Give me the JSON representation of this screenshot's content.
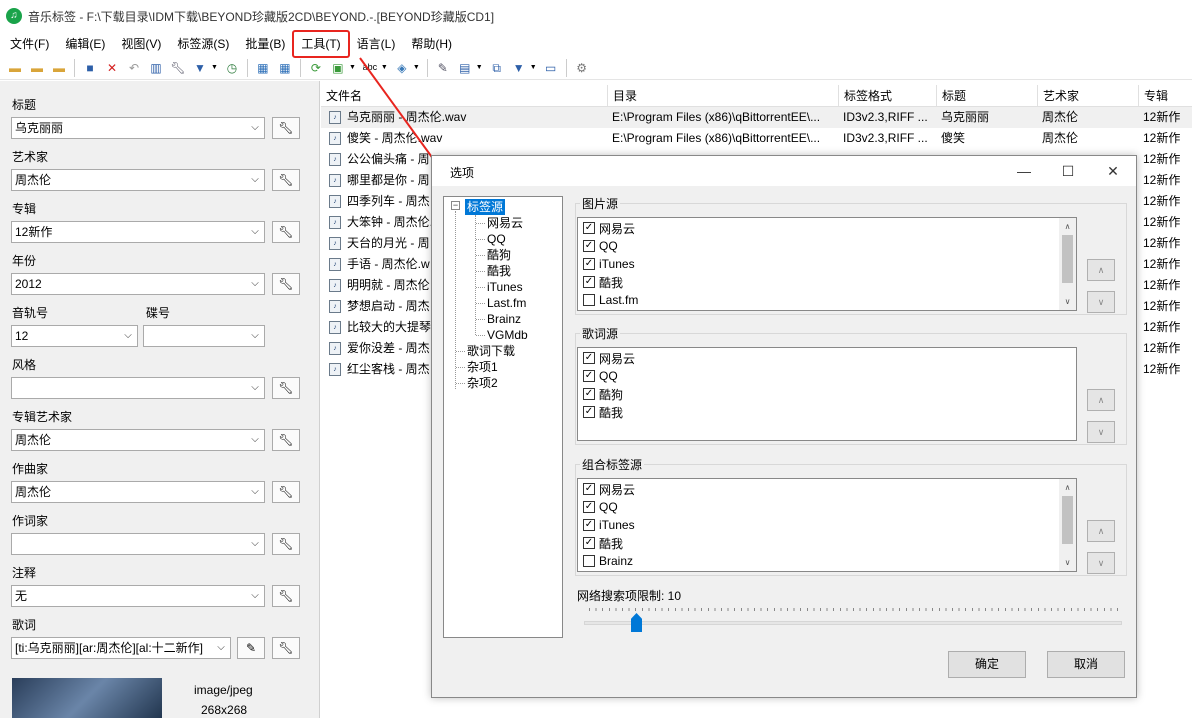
{
  "window": {
    "title": "音乐标签 - F:\\下载目录\\IDM下载\\BEYOND珍藏版2CD\\BEYOND.-.[BEYOND珍藏版CD1]",
    "app_icon": "music-note-icon"
  },
  "menu": [
    {
      "label": "文件(F)"
    },
    {
      "label": "编辑(E)"
    },
    {
      "label": "视图(V)"
    },
    {
      "label": "标签源(S)"
    },
    {
      "label": "批量(B)"
    },
    {
      "label": "工具(T)",
      "highlighted": true
    },
    {
      "label": "语言(L)"
    },
    {
      "label": "帮助(H)"
    }
  ],
  "left_panel": {
    "fields": {
      "title": {
        "label": "标题",
        "value": "乌克丽丽"
      },
      "artist": {
        "label": "艺术家",
        "value": "周杰伦"
      },
      "album": {
        "label": "专辑",
        "value": "12新作"
      },
      "year": {
        "label": "年份",
        "value": "2012"
      },
      "track": {
        "label": "音轨号",
        "value": "12"
      },
      "disc": {
        "label": "碟号",
        "value": ""
      },
      "genre": {
        "label": "风格",
        "value": ""
      },
      "album_artist": {
        "label": "专辑艺术家",
        "value": "周杰伦"
      },
      "composer": {
        "label": "作曲家",
        "value": "周杰伦"
      },
      "lyricist": {
        "label": "作词家",
        "value": ""
      },
      "comment": {
        "label": "注释",
        "value": "无"
      },
      "lyrics": {
        "label": "歌词",
        "value": "[ti:乌克丽丽][ar:周杰伦][al:十二新作]"
      }
    },
    "cover": {
      "mime": "image/jpeg",
      "dims": "268x268"
    }
  },
  "file_list": {
    "columns": [
      "文件名",
      "目录",
      "标签格式",
      "标题",
      "艺术家",
      "专辑"
    ],
    "rows": [
      {
        "filename": "乌克丽丽 - 周杰伦.wav",
        "dir": "E:\\Program Files (x86)\\qBittorrentEE\\...",
        "format": "ID3v2.3,RIFF ...",
        "title": "乌克丽丽",
        "artist": "周杰伦",
        "album": "12新作"
      },
      {
        "filename": "傻笑 - 周杰伦.wav",
        "dir": "E:\\Program Files (x86)\\qBittorrentEE\\...",
        "format": "ID3v2.3,RIFF ...",
        "title": "傻笑",
        "artist": "周杰伦",
        "album": "12新作"
      },
      {
        "filename": "公公偏头痛 - 周",
        "dir": "",
        "format": "",
        "title": "",
        "artist": "",
        "album": "12新作"
      },
      {
        "filename": "哪里都是你 - 周",
        "dir": "",
        "format": "",
        "title": "",
        "artist": "",
        "album": "12新作"
      },
      {
        "filename": "四季列车 - 周杰",
        "dir": "",
        "format": "",
        "title": "",
        "artist": "",
        "album": "12新作"
      },
      {
        "filename": "大笨钟 - 周杰伦.",
        "dir": "",
        "format": "",
        "title": "",
        "artist": "",
        "album": "12新作"
      },
      {
        "filename": "天台的月光 - 周",
        "dir": "",
        "format": "",
        "title": "",
        "artist": "",
        "album": "12新作"
      },
      {
        "filename": "手语 - 周杰伦.w",
        "dir": "",
        "format": "",
        "title": "",
        "artist": "",
        "album": "12新作"
      },
      {
        "filename": "明明就 - 周杰伦",
        "dir": "",
        "format": "",
        "title": "",
        "artist": "",
        "album": "12新作"
      },
      {
        "filename": "梦想启动 - 周杰",
        "dir": "",
        "format": "",
        "title": "",
        "artist": "",
        "album": "12新作"
      },
      {
        "filename": "比较大的大提琴",
        "dir": "",
        "format": "",
        "title": "",
        "artist": "",
        "album": "12新作"
      },
      {
        "filename": "爱你没差 - 周杰",
        "dir": "",
        "format": "",
        "title": "",
        "artist": "",
        "album": "12新作"
      },
      {
        "filename": "红尘客栈 - 周杰",
        "dir": "",
        "format": "",
        "title": "",
        "artist": "",
        "album": "12新作"
      }
    ]
  },
  "dialog": {
    "title": "选项",
    "tree": {
      "root": "标签源",
      "children": [
        "网易云",
        "QQ",
        "酷狗",
        "酷我",
        "iTunes",
        "Last.fm",
        "Brainz",
        "VGMdb"
      ],
      "others": [
        "歌词下载",
        "杂项1",
        "杂项2"
      ]
    },
    "picture_source": {
      "title": "图片源",
      "items": [
        {
          "label": "网易云",
          "checked": true
        },
        {
          "label": "QQ",
          "checked": true
        },
        {
          "label": "iTunes",
          "checked": true
        },
        {
          "label": "酷我",
          "checked": true
        },
        {
          "label": "Last.fm",
          "checked": false
        }
      ]
    },
    "lyrics_source": {
      "title": "歌词源",
      "items": [
        {
          "label": "网易云",
          "checked": true
        },
        {
          "label": "QQ",
          "checked": true
        },
        {
          "label": "酷狗",
          "checked": true
        },
        {
          "label": "酷我",
          "checked": true
        }
      ]
    },
    "combined_source": {
      "title": "组合标签源",
      "items": [
        {
          "label": "网易云",
          "checked": true
        },
        {
          "label": "QQ",
          "checked": true
        },
        {
          "label": "iTunes",
          "checked": true
        },
        {
          "label": "酷我",
          "checked": true
        },
        {
          "label": "Brainz",
          "checked": false
        }
      ]
    },
    "net_limit": {
      "label": "网络搜索项限制: 10",
      "value": 10
    },
    "ok": "确定",
    "cancel": "取消"
  },
  "colors": {
    "accent": "#0078d7",
    "annotation": "#e8251f"
  }
}
